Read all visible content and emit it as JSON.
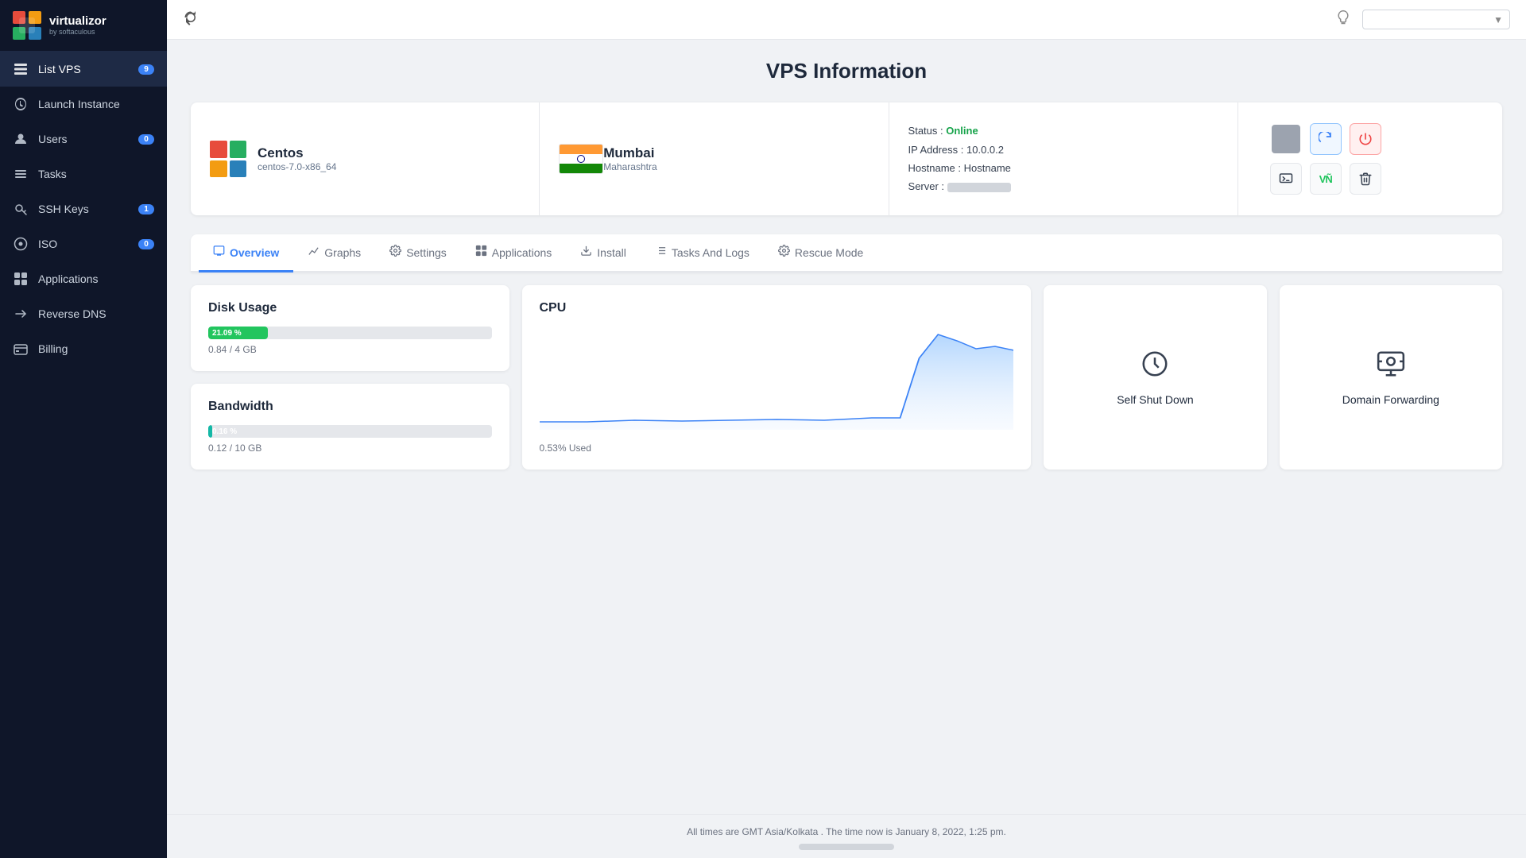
{
  "sidebar": {
    "logo": {
      "brand": "virtualizor",
      "sub": "by softaculous"
    },
    "items": [
      {
        "id": "list-vps",
        "label": "List VPS",
        "icon": "≡",
        "badge": "9",
        "badgeColor": "blue"
      },
      {
        "id": "launch-instance",
        "label": "Launch Instance",
        "icon": "☁",
        "badge": null
      },
      {
        "id": "users",
        "label": "Users",
        "icon": "👤",
        "badge": "0",
        "badgeColor": "blue"
      },
      {
        "id": "tasks",
        "label": "Tasks",
        "icon": "☰",
        "badge": null
      },
      {
        "id": "ssh-keys",
        "label": "SSH Keys",
        "icon": "🔑",
        "badge": "1",
        "badgeColor": "blue"
      },
      {
        "id": "iso",
        "label": "ISO",
        "icon": "💿",
        "badge": "0",
        "badgeColor": "blue"
      },
      {
        "id": "applications",
        "label": "Applications",
        "icon": "⊞",
        "badge": null
      },
      {
        "id": "reverse-dns",
        "label": "Reverse DNS",
        "icon": "↩",
        "badge": null
      },
      {
        "id": "billing",
        "label": "Billing",
        "icon": "💳",
        "badge": null
      }
    ]
  },
  "topbar": {
    "search_placeholder": ""
  },
  "page": {
    "title": "VPS Information"
  },
  "vps_info": {
    "os": {
      "name": "Centos",
      "version": "centos-7.0-x86_64"
    },
    "location": {
      "city": "Mumbai",
      "state": "Maharashtra"
    },
    "status": {
      "label": "Status :",
      "value": "Online",
      "ip_label": "IP Address :",
      "ip": "10.0.0.2",
      "hostname_label": "Hostname :",
      "hostname": "Hostname",
      "server_label": "Server :"
    }
  },
  "tabs": [
    {
      "id": "overview",
      "label": "Overview",
      "icon": "🖥",
      "active": true
    },
    {
      "id": "graphs",
      "label": "Graphs",
      "icon": "📈"
    },
    {
      "id": "settings",
      "label": "Settings",
      "icon": "⚙"
    },
    {
      "id": "applications",
      "label": "Applications",
      "icon": "⊞"
    },
    {
      "id": "install",
      "label": "Install",
      "icon": "⬇"
    },
    {
      "id": "tasks-logs",
      "label": "Tasks And Logs",
      "icon": "≡"
    },
    {
      "id": "rescue-mode",
      "label": "Rescue Mode",
      "icon": "⚙"
    }
  ],
  "stats": {
    "disk": {
      "title": "Disk Usage",
      "percent": "21.09 %",
      "fill_width": 21,
      "detail": "0.84 / 4 GB"
    },
    "bandwidth": {
      "title": "Bandwidth",
      "percent": "0.16 %",
      "fill_width": 1,
      "detail": "0.12 / 10 GB"
    },
    "cpu": {
      "title": "CPU",
      "used": "0.53% Used"
    }
  },
  "action_cards": {
    "shutdown": {
      "label": "Self Shut Down",
      "icon": "🕐"
    },
    "domain": {
      "label": "Domain Forwarding",
      "icon": "🌐"
    }
  },
  "footer": {
    "text": "All times are GMT Asia/Kolkata . The time now is January 8, 2022, 1:25 pm."
  }
}
